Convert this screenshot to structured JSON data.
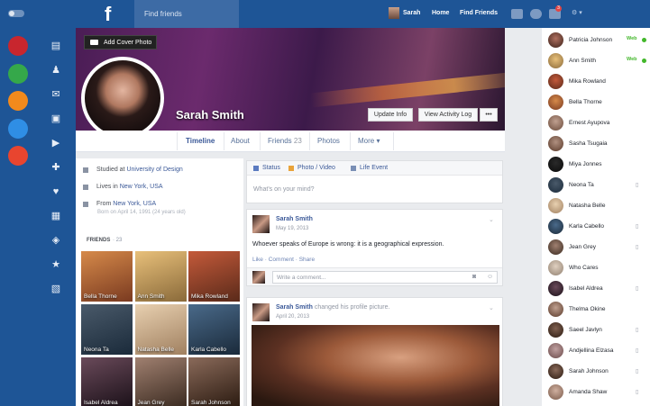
{
  "topbar": {
    "logo": "f",
    "search_placeholder": "Find friends",
    "user_name": "Sarah",
    "home": "Home",
    "find_friends": "Find Friends",
    "notification_count": "3",
    "menu_label": "⚙ ▾"
  },
  "left_nav": {
    "circle_icons": [
      {
        "name": "uk-flag-icon",
        "color": "#c8262e"
      },
      {
        "name": "rss-icon",
        "color": "#35a84a"
      },
      {
        "name": "glasses-icon",
        "color": "#f28a1c"
      },
      {
        "name": "notes-icon",
        "color": "#2f8ee5"
      },
      {
        "name": "info-icon",
        "color": "#e8452f"
      }
    ],
    "nav_icons": [
      "document-icon",
      "users-icon",
      "mail-icon",
      "contact-card-icon",
      "video-icon",
      "gamepad-icon",
      "heart-icon",
      "calendar-icon",
      "shield-icon",
      "star-icon",
      "box-icon"
    ]
  },
  "profile": {
    "add_cover": "Add Cover Photo",
    "name": "Sarah Smith",
    "update_info": "Update Info",
    "view_log": "View Activity Log",
    "more_dots": "•••"
  },
  "tabs": {
    "timeline": "Timeline",
    "about": "About",
    "friends": "Friends",
    "friends_count": "23",
    "photos": "Photos",
    "more": "More"
  },
  "about": {
    "studied_prefix": "Studied at",
    "studied_link": "University of Design",
    "lives_prefix": "Lives in",
    "lives_link": "New York, USA",
    "from_prefix": "From",
    "from_link": "New York, USA",
    "born": "Born on April 14, 1991 (24 years old)"
  },
  "friends_panel": {
    "header": "FRIENDS",
    "separator": "·",
    "count": "23",
    "friends": [
      {
        "name": "Bella Thorne",
        "colors": [
          "#d68a4a",
          "#7a3a20"
        ]
      },
      {
        "name": "Ann Smith",
        "colors": [
          "#e8c07a",
          "#8a6a3a"
        ]
      },
      {
        "name": "Mika Rowland",
        "colors": [
          "#c45a3a",
          "#5a2a1a"
        ]
      },
      {
        "name": "Neona Ta",
        "colors": [
          "#4a5a6a",
          "#1a2a3a"
        ]
      },
      {
        "name": "Natasha Belle",
        "colors": [
          "#e8d0b0",
          "#a08060"
        ]
      },
      {
        "name": "Karla Cabello",
        "colors": [
          "#4a6a8a",
          "#1a2a3a"
        ]
      },
      {
        "name": "Isabel Aldrea",
        "colors": [
          "#6a4a5a",
          "#1a1018"
        ]
      },
      {
        "name": "Jean Grey",
        "colors": [
          "#a08070",
          "#3a2a20"
        ]
      },
      {
        "name": "Sarah Johnson",
        "colors": [
          "#8a6a5a",
          "#2a1a10"
        ]
      }
    ]
  },
  "composer": {
    "status": "Status",
    "photo_video": "Photo / Video",
    "life_event": "Life Event",
    "placeholder": "What's on your mind?"
  },
  "post1": {
    "author": "Sarah Smith",
    "date": "May 19, 2013",
    "text": "Whoever speaks of Europe is wrong: it is a geographical expression.",
    "like": "Like",
    "comment": "Comment",
    "share": "Share",
    "dot": "·",
    "comment_placeholder": "Write a comment..."
  },
  "post2": {
    "author": "Sarah Smith",
    "action": "changed his profile picture.",
    "date": "April 20, 2013"
  },
  "chat": [
    {
      "name": "Patricia Johnson",
      "status": "Web",
      "colors": [
        "#b07060",
        "#3a2018"
      ]
    },
    {
      "name": "Ann Smith",
      "status": "Web",
      "colors": [
        "#e8c07a",
        "#8a6a3a"
      ]
    },
    {
      "name": "Mika Rowland",
      "status": "",
      "colors": [
        "#c45a3a",
        "#5a2a1a"
      ]
    },
    {
      "name": "Bella Thorne",
      "status": "",
      "colors": [
        "#d68a4a",
        "#7a3a20"
      ]
    },
    {
      "name": "Ernest Ayupova",
      "status": "",
      "colors": [
        "#c0a090",
        "#6a4a3a"
      ]
    },
    {
      "name": "Sasha Tsugaia",
      "status": "",
      "colors": [
        "#b09080",
        "#5a3a2a"
      ]
    },
    {
      "name": "Miya Jonnes",
      "status": "",
      "colors": [
        "#2a2a2a",
        "#0a0a0a"
      ]
    },
    {
      "name": "Neona Ta",
      "status": "phone",
      "colors": [
        "#4a5a6a",
        "#1a2a3a"
      ]
    },
    {
      "name": "Natasha Belle",
      "status": "",
      "colors": [
        "#e8d0b0",
        "#a08060"
      ]
    },
    {
      "name": "Karla Cabello",
      "status": "phone",
      "colors": [
        "#4a6a8a",
        "#1a2a3a"
      ]
    },
    {
      "name": "Jean Grey",
      "status": "phone",
      "colors": [
        "#a08070",
        "#3a2a20"
      ]
    },
    {
      "name": "Who Cares",
      "status": "",
      "colors": [
        "#e0d0c0",
        "#908070"
      ]
    },
    {
      "name": "Isabel Aldrea",
      "status": "phone",
      "colors": [
        "#6a4a5a",
        "#1a1018"
      ]
    },
    {
      "name": "Thelma Okine",
      "status": "",
      "colors": [
        "#c0a090",
        "#5a3a2a"
      ]
    },
    {
      "name": "Saeel Javlyn",
      "status": "phone",
      "colors": [
        "#806050",
        "#2a1a10"
      ]
    },
    {
      "name": "Andjellina Elzasa",
      "status": "phone",
      "colors": [
        "#c0a0a0",
        "#6a4a4a"
      ]
    },
    {
      "name": "Sarah Johnson",
      "status": "phone",
      "colors": [
        "#8a6a5a",
        "#2a1a10"
      ]
    },
    {
      "name": "Amanda Shaw",
      "status": "phone",
      "colors": [
        "#d0b0a0",
        "#7a5a4a"
      ]
    }
  ]
}
